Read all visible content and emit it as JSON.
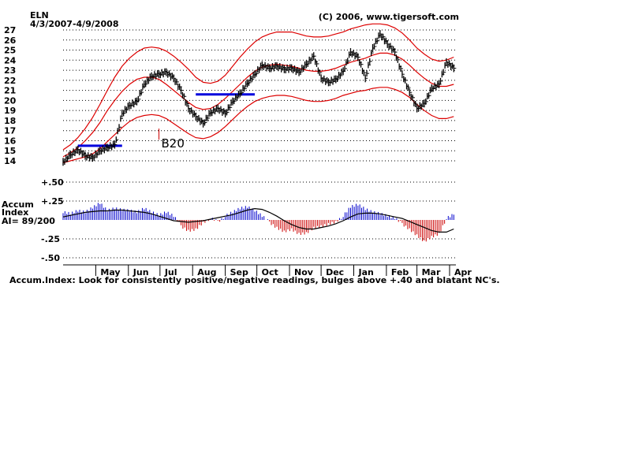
{
  "header": {
    "ticker": "ELN",
    "date_range": "4/3/2007-4/9/2008",
    "copyright": "(C) 2006, www.tigersoft.com"
  },
  "accum_labels": {
    "line1": "Accum",
    "line2": "Index",
    "line3": "AI= 89/200"
  },
  "footer_note": "Accum.Index: Look for consistently positive/negative readings, bulges above +.40 and blatant NC's.",
  "annotation": {
    "text": "B20",
    "x": "2007-07-03",
    "y": 17.2
  },
  "colors": {
    "price_bars": "#000000",
    "bands": "#dd0000",
    "resistance_lines": "#0000dd",
    "accum_positive": "#0000cc",
    "accum_negative": "#cc0000",
    "accum_average": "#000000",
    "grid": "#000000"
  },
  "chart_data": [
    {
      "type": "line",
      "subtype": "ohlc_price_with_bands",
      "ticker": "ELN",
      "date_range": "4/3/2007-4/9/2008",
      "x": [
        "2007-04-03",
        "2007-04-10",
        "2007-04-17",
        "2007-04-24",
        "2007-05-01",
        "2007-05-08",
        "2007-05-15",
        "2007-05-22",
        "2007-05-29",
        "2007-06-05",
        "2007-06-12",
        "2007-06-19",
        "2007-06-26",
        "2007-07-03",
        "2007-07-10",
        "2007-07-17",
        "2007-07-24",
        "2007-07-31",
        "2007-08-07",
        "2007-08-14",
        "2007-08-21",
        "2007-08-28",
        "2007-09-04",
        "2007-09-11",
        "2007-09-18",
        "2007-09-25",
        "2007-10-02",
        "2007-10-09",
        "2007-10-16",
        "2007-10-23",
        "2007-10-30",
        "2007-11-06",
        "2007-11-13",
        "2007-11-20",
        "2007-11-27",
        "2007-12-04",
        "2007-12-11",
        "2007-12-18",
        "2007-12-25",
        "2008-01-01",
        "2008-01-08",
        "2008-01-15",
        "2008-01-22",
        "2008-01-29",
        "2008-02-05",
        "2008-02-12",
        "2008-02-19",
        "2008-02-26",
        "2008-03-04",
        "2008-03-11",
        "2008-03-18",
        "2008-03-25",
        "2008-04-01",
        "2008-04-08"
      ],
      "yticks": [
        14,
        15,
        16,
        17,
        18,
        19,
        20,
        21,
        22,
        23,
        24,
        25,
        26,
        27
      ],
      "ylim": [
        13.8,
        27.3
      ],
      "series": [
        {
          "values": [
            13.9,
            14.6,
            15.1,
            14.5,
            14.3,
            15.0,
            15.3,
            15.6,
            18.7,
            19.5,
            19.9,
            21.6,
            22.4,
            22.6,
            22.8,
            22.2,
            21.0,
            19.2,
            18.4,
            17.7,
            18.8,
            19.2,
            18.7,
            19.9,
            20.7,
            21.7,
            22.6,
            23.5,
            23.2,
            23.4,
            23.1,
            23.2,
            22.8,
            23.6,
            24.4,
            22.2,
            21.8,
            22.1,
            22.9,
            24.8,
            24.3,
            22.2,
            25.2,
            26.6,
            25.6,
            24.8,
            22.6,
            20.8,
            19.2,
            19.7,
            21.2,
            21.6,
            23.8,
            23.2
          ]
        },
        {
          "name": "upper band",
          "values": [
            15.1,
            15.6,
            16.3,
            17.2,
            18.3,
            19.6,
            21.0,
            22.3,
            23.4,
            24.2,
            24.8,
            25.2,
            25.3,
            25.2,
            24.9,
            24.4,
            23.8,
            23.1,
            22.3,
            21.8,
            21.7,
            21.9,
            22.5,
            23.4,
            24.3,
            25.1,
            25.8,
            26.3,
            26.6,
            26.8,
            26.8,
            26.8,
            26.6,
            26.4,
            26.3,
            26.3,
            26.4,
            26.6,
            26.8,
            27.1,
            27.3,
            27.5,
            27.6,
            27.6,
            27.5,
            27.2,
            26.7,
            26.0,
            25.2,
            24.6,
            24.1,
            23.9,
            24.0,
            24.3
          ]
        },
        {
          "name": "middle band",
          "values": [
            14.4,
            14.8,
            15.3,
            16.0,
            16.8,
            17.8,
            19.0,
            20.0,
            20.9,
            21.6,
            22.1,
            22.3,
            22.3,
            22.1,
            21.6,
            21.0,
            20.4,
            19.8,
            19.3,
            19.1,
            19.2,
            19.6,
            20.2,
            20.9,
            21.6,
            22.3,
            22.9,
            23.3,
            23.5,
            23.6,
            23.5,
            23.4,
            23.2,
            23.0,
            22.9,
            22.9,
            23.0,
            23.2,
            23.5,
            23.8,
            24.0,
            24.2,
            24.5,
            24.7,
            24.7,
            24.5,
            24.1,
            23.5,
            22.8,
            22.2,
            21.7,
            21.4,
            21.4,
            21.6
          ]
        },
        {
          "name": "lower band",
          "values": [
            13.8,
            14.0,
            14.2,
            14.4,
            14.7,
            15.2,
            15.9,
            16.6,
            17.3,
            17.9,
            18.3,
            18.5,
            18.6,
            18.5,
            18.2,
            17.7,
            17.2,
            16.7,
            16.3,
            16.2,
            16.4,
            16.8,
            17.4,
            18.1,
            18.8,
            19.4,
            19.9,
            20.2,
            20.4,
            20.5,
            20.5,
            20.4,
            20.2,
            20.0,
            19.9,
            19.9,
            20.0,
            20.2,
            20.5,
            20.7,
            20.9,
            21.0,
            21.2,
            21.3,
            21.3,
            21.1,
            20.8,
            20.3,
            19.6,
            19.0,
            18.5,
            18.2,
            18.2,
            18.4
          ]
        }
      ],
      "annotations": [
        {
          "type": "hline",
          "y": 15.5,
          "x_start": "2007-04-17",
          "x_end": "2007-05-29",
          "color": "#0000dd"
        },
        {
          "type": "hline",
          "y": 20.6,
          "x_start": "2007-08-07",
          "x_end": "2007-10-02",
          "color": "#0000dd"
        }
      ],
      "grid": true
    },
    {
      "type": "bar",
      "subtype": "accumulation_index",
      "x": [
        "2007-04-03",
        "2007-04-10",
        "2007-04-17",
        "2007-04-24",
        "2007-05-01",
        "2007-05-08",
        "2007-05-15",
        "2007-05-22",
        "2007-05-29",
        "2007-06-05",
        "2007-06-12",
        "2007-06-19",
        "2007-06-26",
        "2007-07-03",
        "2007-07-10",
        "2007-07-17",
        "2007-07-24",
        "2007-07-31",
        "2007-08-07",
        "2007-08-14",
        "2007-08-21",
        "2007-08-28",
        "2007-09-04",
        "2007-09-11",
        "2007-09-18",
        "2007-09-25",
        "2007-10-02",
        "2007-10-09",
        "2007-10-16",
        "2007-10-23",
        "2007-10-30",
        "2007-11-06",
        "2007-11-13",
        "2007-11-20",
        "2007-11-27",
        "2007-12-04",
        "2007-12-11",
        "2007-12-18",
        "2007-12-25",
        "2008-01-01",
        "2008-01-08",
        "2008-01-15",
        "2008-01-22",
        "2008-01-29",
        "2008-02-05",
        "2008-02-12",
        "2008-02-19",
        "2008-02-26",
        "2008-03-04",
        "2008-03-11",
        "2008-03-18",
        "2008-03-25",
        "2008-04-01",
        "2008-04-08"
      ],
      "yticks": [
        "+.50",
        "+.25",
        "-.25",
        "-.50"
      ],
      "yticks_values": [
        0.5,
        0.25,
        -0.25,
        -0.5
      ],
      "ylim": [
        -0.55,
        0.55
      ],
      "series": [
        {
          "values": [
            0.1,
            0.08,
            0.12,
            0.1,
            0.16,
            0.22,
            0.12,
            0.15,
            0.13,
            0.12,
            0.1,
            0.15,
            0.1,
            0.06,
            0.1,
            0.05,
            -0.08,
            -0.14,
            -0.12,
            -0.03,
            0.02,
            -0.02,
            0.05,
            0.1,
            0.15,
            0.17,
            0.12,
            0.05,
            -0.03,
            -0.1,
            -0.15,
            -0.12,
            -0.18,
            -0.17,
            -0.1,
            -0.08,
            -0.05,
            -0.02,
            0.05,
            0.17,
            0.2,
            0.14,
            0.1,
            0.08,
            0.05,
            0.02,
            -0.05,
            -0.12,
            -0.2,
            -0.28,
            -0.22,
            -0.18,
            0.02,
            0.07
          ]
        },
        {
          "name": "average",
          "values": [
            0.04,
            0.06,
            0.08,
            0.1,
            0.11,
            0.12,
            0.12,
            0.13,
            0.13,
            0.12,
            0.11,
            0.1,
            0.08,
            0.05,
            0.02,
            -0.01,
            -0.02,
            -0.03,
            -0.02,
            -0.01,
            0.01,
            0.03,
            0.05,
            0.07,
            0.1,
            0.13,
            0.15,
            0.14,
            0.1,
            0.05,
            -0.01,
            -0.06,
            -0.1,
            -0.12,
            -0.12,
            -0.1,
            -0.08,
            -0.05,
            -0.01,
            0.04,
            0.08,
            0.09,
            0.09,
            0.08,
            0.06,
            0.04,
            0.02,
            -0.02,
            -0.06,
            -0.1,
            -0.14,
            -0.16,
            -0.16,
            -0.12
          ]
        }
      ],
      "grid": true
    }
  ],
  "months": [
    {
      "label": "May",
      "x": "2007-05-04"
    },
    {
      "label": "Jun",
      "x": "2007-06-04"
    },
    {
      "label": "Jul",
      "x": "2007-07-04"
    },
    {
      "label": "Aug",
      "x": "2007-08-04"
    },
    {
      "label": "Sep",
      "x": "2007-09-04"
    },
    {
      "label": "Oct",
      "x": "2007-10-04"
    },
    {
      "label": "Nov",
      "x": "2007-11-04"
    },
    {
      "label": "Dec",
      "x": "2007-12-04"
    },
    {
      "label": "Jan",
      "x": "2008-01-04"
    },
    {
      "label": "Feb",
      "x": "2008-02-04"
    },
    {
      "label": "Mar",
      "x": "2008-03-04"
    },
    {
      "label": "Apr",
      "x": "2008-04-04"
    }
  ]
}
